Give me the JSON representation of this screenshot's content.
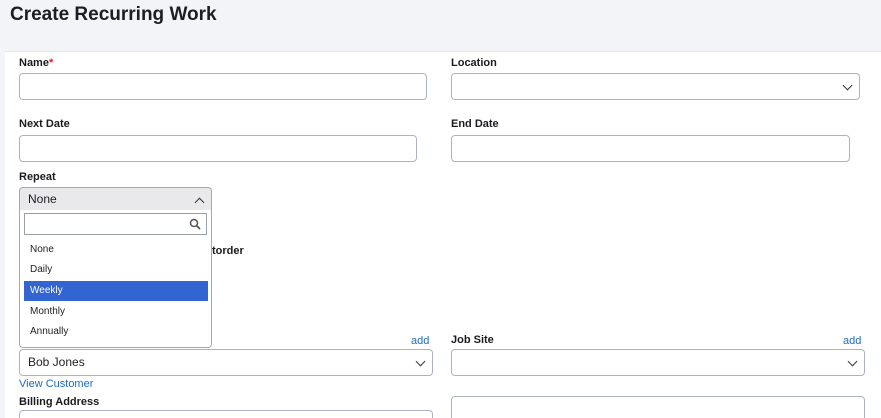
{
  "page": {
    "title": "Create Recurring Work"
  },
  "form": {
    "name_label": "Name",
    "name_required_mark": "*",
    "name_value": "",
    "location_label": "Location",
    "location_value": "",
    "next_date_label": "Next Date",
    "next_date_value": "",
    "end_date_label": "End Date",
    "end_date_value": "",
    "repeat_label": "Repeat",
    "repeat_value": "None",
    "repeat_search_value": "",
    "repeat_options": [
      "None",
      "Daily",
      "Weekly",
      "Monthly",
      "Annually"
    ],
    "repeat_highlighted": "Weekly",
    "obscured_label_fragment": "torder",
    "customer_add_link": "add",
    "customer_value": "Bob Jones",
    "view_customer_link": "View Customer",
    "job_site_label": "Job Site",
    "job_site_add_link": "add",
    "job_site_value": "",
    "billing_address_label": "Billing Address"
  },
  "icons": {
    "select_arrow": "chevron-down-icon",
    "repeat_arrow": "chevron-up-icon",
    "search": "search-icon"
  },
  "colors": {
    "link": "#1f6bbf",
    "required": "#d0222e",
    "highlight": "#3264d2"
  }
}
